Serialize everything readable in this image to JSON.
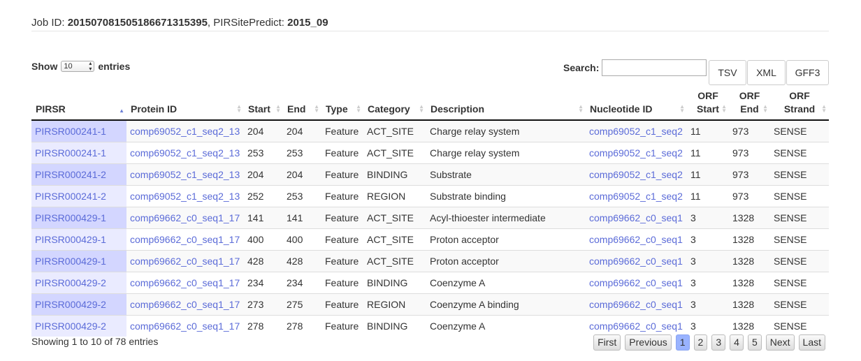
{
  "header": {
    "job_label": "Job ID:",
    "job_id": "2015070815051866713153​95",
    "tool_label": "PIRSitePredict:",
    "tool_version": "2015_09"
  },
  "length": {
    "show_label": "Show",
    "value": "10",
    "entries_label": "entries"
  },
  "search": {
    "label": "Search:",
    "value": ""
  },
  "exports": [
    "TSV",
    "XML",
    "GFF3"
  ],
  "table": {
    "columns": [
      [
        "PIRSR",
        ""
      ],
      [
        "Protein ID",
        ""
      ],
      [
        "Start",
        ""
      ],
      [
        "End",
        ""
      ],
      [
        "Type",
        ""
      ],
      [
        "Category",
        ""
      ],
      [
        "Description",
        ""
      ],
      [
        "Nucleotide ID",
        ""
      ],
      [
        "ORF",
        "Start"
      ],
      [
        "ORF",
        "End"
      ],
      [
        "ORF",
        "Strand"
      ]
    ],
    "rows": [
      [
        "PIRSR000241-1",
        "comp69052_c1_seq2_13",
        "204",
        "204",
        "Feature",
        "ACT_SITE",
        "Charge relay system",
        "comp69052_c1_seq2",
        "11",
        "973",
        "SENSE"
      ],
      [
        "PIRSR000241-1",
        "comp69052_c1_seq2_13",
        "253",
        "253",
        "Feature",
        "ACT_SITE",
        "Charge relay system",
        "comp69052_c1_seq2",
        "11",
        "973",
        "SENSE"
      ],
      [
        "PIRSR000241-2",
        "comp69052_c1_seq2_13",
        "204",
        "204",
        "Feature",
        "BINDING",
        "Substrate",
        "comp69052_c1_seq2",
        "11",
        "973",
        "SENSE"
      ],
      [
        "PIRSR000241-2",
        "comp69052_c1_seq2_13",
        "252",
        "253",
        "Feature",
        "REGION",
        "Substrate binding",
        "comp69052_c1_seq2",
        "11",
        "973",
        "SENSE"
      ],
      [
        "PIRSR000429-1",
        "comp69662_c0_seq1_17",
        "141",
        "141",
        "Feature",
        "ACT_SITE",
        "Acyl-thioester intermediate",
        "comp69662_c0_seq1",
        "3",
        "1328",
        "SENSE"
      ],
      [
        "PIRSR000429-1",
        "comp69662_c0_seq1_17",
        "400",
        "400",
        "Feature",
        "ACT_SITE",
        "Proton acceptor",
        "comp69662_c0_seq1",
        "3",
        "1328",
        "SENSE"
      ],
      [
        "PIRSR000429-1",
        "comp69662_c0_seq1_17",
        "428",
        "428",
        "Feature",
        "ACT_SITE",
        "Proton acceptor",
        "comp69662_c0_seq1",
        "3",
        "1328",
        "SENSE"
      ],
      [
        "PIRSR000429-2",
        "comp69662_c0_seq1_17",
        "234",
        "234",
        "Feature",
        "BINDING",
        "Coenzyme A",
        "comp69662_c0_seq1",
        "3",
        "1328",
        "SENSE"
      ],
      [
        "PIRSR000429-2",
        "comp69662_c0_seq1_17",
        "273",
        "275",
        "Feature",
        "REGION",
        "Coenzyme A binding",
        "comp69662_c0_seq1",
        "3",
        "1328",
        "SENSE"
      ],
      [
        "PIRSR000429-2",
        "comp69662_c0_seq1_17",
        "278",
        "278",
        "Feature",
        "BINDING",
        "Coenzyme A",
        "comp69662_c0_seq1",
        "3",
        "1328",
        "SENSE"
      ]
    ]
  },
  "footer": {
    "info": "Showing 1 to 10 of 78 entries",
    "pager": [
      "First",
      "Previous",
      "1",
      "2",
      "3",
      "4",
      "5",
      "Next",
      "Last"
    ],
    "current_page": "1"
  },
  "colors": {
    "link": "#5b6bd8",
    "sorted_col": "#d3d6ff",
    "current_page": "#99b3ff"
  }
}
